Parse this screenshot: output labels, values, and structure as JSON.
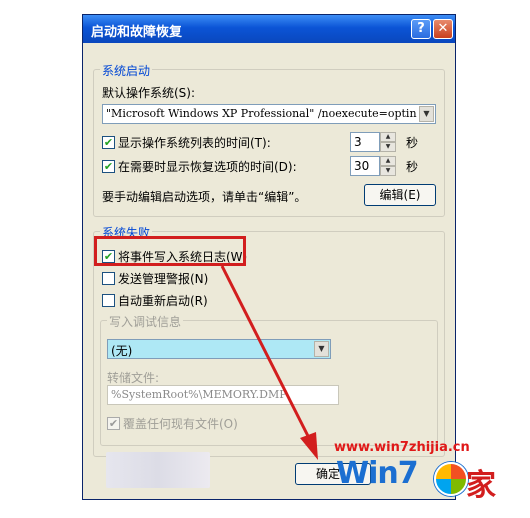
{
  "window": {
    "title": "启动和故障恢复",
    "help_label": "?",
    "close_label": "✕"
  },
  "startup": {
    "legend": "系统启动",
    "default_os_label": "默认操作系统(S):",
    "default_os_value": "\"Microsoft Windows XP Professional\" /noexecute=optin",
    "show_os_list_label": "显示操作系统列表的时间(T):",
    "show_os_list_checked": true,
    "show_os_list_value": "3",
    "show_recovery_label": "在需要时显示恢复选项的时间(D):",
    "show_recovery_checked": true,
    "show_recovery_value": "30",
    "seconds_unit": "秒",
    "edit_hint": "要手动编辑启动选项，请单击“编辑”。",
    "edit_button": "编辑(E)"
  },
  "failure": {
    "legend": "系统失败",
    "write_event_label": "将事件写入系统日志(W)",
    "write_event_checked": true,
    "send_alert_label": "发送管理警报(N)",
    "send_alert_checked": false,
    "auto_restart_label": "自动重新启动(R)",
    "auto_restart_checked": false,
    "debug": {
      "legend": "写入调试信息",
      "type_value": "(无)",
      "dump_file_label": "转储文件:",
      "dump_file_value": "%SystemRoot%\\MEMORY.DMP",
      "overwrite_label": "覆盖任何现有文件(O)",
      "overwrite_checked": true
    }
  },
  "footer": {
    "ok_button": "确定"
  },
  "watermark": {
    "url": "www.win7zhijia.cn",
    "logo_text": "Win7",
    "logo_suffix": "家"
  },
  "colors": {
    "titlebar": "#0b54d6",
    "highlight": "#d21e1e",
    "combo_blue": "#aee8f5"
  }
}
